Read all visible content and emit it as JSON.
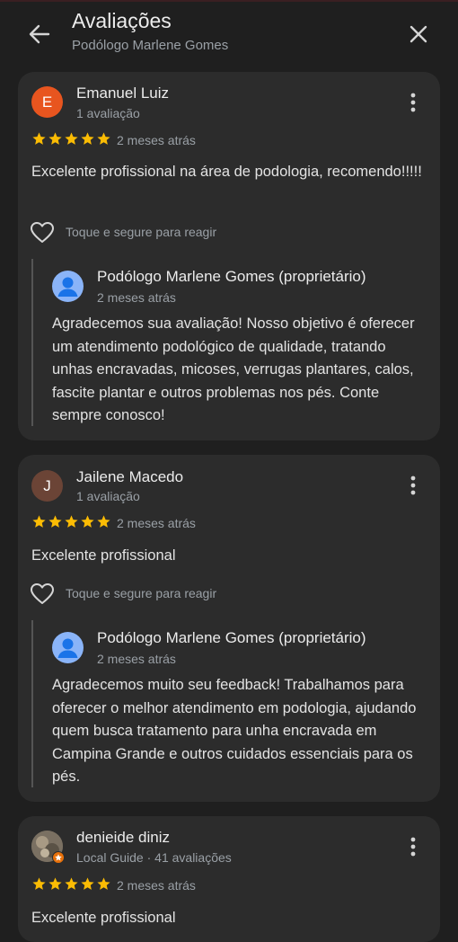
{
  "header": {
    "title": "Avaliações",
    "subtitle": "Podólogo Marlene Gomes",
    "back_icon": "arrow-left-icon",
    "close_icon": "close-icon"
  },
  "reviews": [
    {
      "initial": "E",
      "avatar_color": "#e8551f",
      "name": "Emanuel Luiz",
      "meta": "1 avaliação",
      "rating": 5,
      "date": "2 meses atrás",
      "text": "Excelente profissional na área de podologia, recomendo!!!!!",
      "react_label": "Toque e segure para reagir",
      "reply": {
        "name": "Podólogo Marlene Gomes (proprietário)",
        "date": "2 meses atrás",
        "text": "Agradecemos sua avaliação! Nosso objetivo é oferecer um atendimento podológico de qualidade, tratando unhas encravadas, micoses, verrugas plantares, calos, fascite plantar e outros problemas nos pés. Conte sempre conosco!"
      }
    },
    {
      "initial": "J",
      "avatar_color": "#6b4436",
      "name": "Jailene Macedo",
      "meta": "1 avaliação",
      "rating": 5,
      "date": "2 meses atrás",
      "text": "Excelente profissional",
      "react_label": "Toque e segure para reagir",
      "reply": {
        "name": "Podólogo Marlene Gomes (proprietário)",
        "date": "2 meses atrás",
        "text": "Agradecemos muito seu feedback! Trabalhamos para oferecer o melhor atendimento em podologia, ajudando quem busca tratamento para unha encravada em Campina Grande e outros cuidados essenciais para os pés."
      }
    },
    {
      "name": "denieide diniz",
      "meta": "Local Guide · 41 avaliações",
      "rating": 5,
      "date": "2 meses atrás",
      "text": "Excelente profissional"
    }
  ],
  "colors": {
    "background": "#1f1f1f",
    "card": "#2c2c2c",
    "star": "#fbbc04",
    "secondary_text": "#9aa0a6",
    "owner_avatar": "#8ab4f8",
    "local_guide_badge": "#e8710a"
  }
}
